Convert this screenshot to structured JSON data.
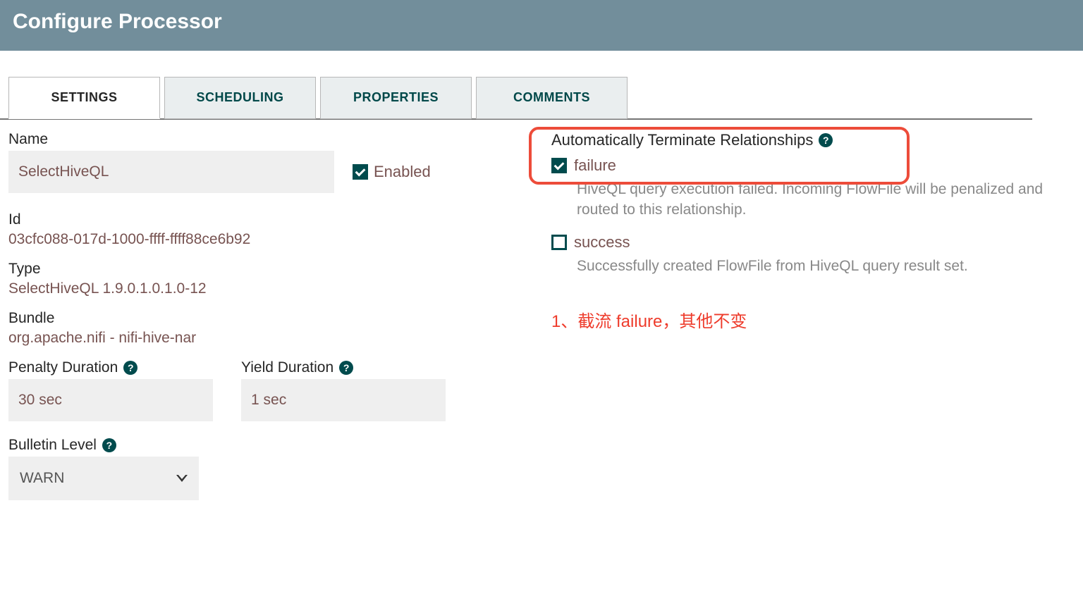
{
  "header": {
    "title": "Configure Processor"
  },
  "tabs": {
    "settings": "SETTINGS",
    "scheduling": "SCHEDULING",
    "properties": "PROPERTIES",
    "comments": "COMMENTS"
  },
  "settings": {
    "name_label": "Name",
    "name_value": "SelectHiveQL",
    "enabled_label": "Enabled",
    "enabled_checked": true,
    "id_label": "Id",
    "id_value": "03cfc088-017d-1000-ffff-ffff88ce6b92",
    "type_label": "Type",
    "type_value": "SelectHiveQL 1.9.0.1.0.1.0-12",
    "bundle_label": "Bundle",
    "bundle_value": "org.apache.nifi - nifi-hive-nar",
    "penalty_label": "Penalty Duration",
    "penalty_value": "30 sec",
    "yield_label": "Yield Duration",
    "yield_value": "1 sec",
    "bulletin_label": "Bulletin Level",
    "bulletin_value": "WARN"
  },
  "relationships": {
    "header": "Automatically Terminate Relationships",
    "items": [
      {
        "name": "failure",
        "checked": true,
        "desc": "HiveQL query execution failed. Incoming FlowFile will be penalized and routed to this relationship."
      },
      {
        "name": "success",
        "checked": false,
        "desc": "Successfully created FlowFile from HiveQL query result set."
      }
    ]
  },
  "annotation": "1、截流 failure，其他不变",
  "glyphs": {
    "help": "?"
  }
}
